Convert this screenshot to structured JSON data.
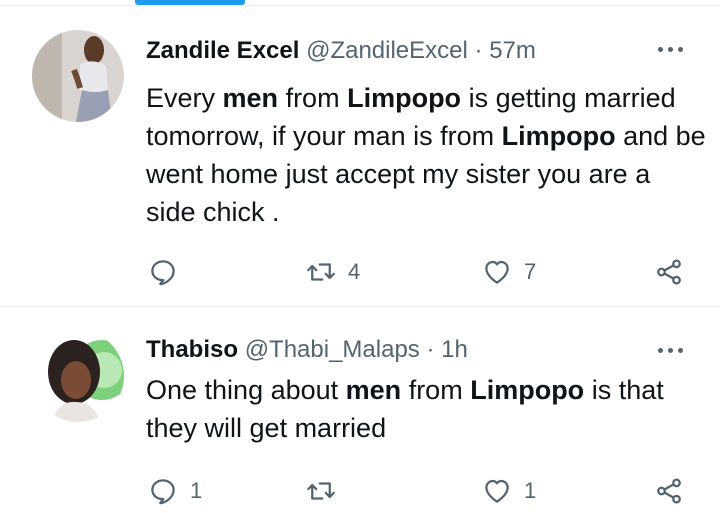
{
  "tweets": [
    {
      "display_name": "Zandile Excel",
      "handle": "@ZandileExcel",
      "separator": "·",
      "time": "57m",
      "text_parts": [
        "Every ",
        "men",
        " from ",
        "Limpopo",
        " is getting married tomorrow, if your man is from ",
        "Limpopo",
        " and be went home just accept my sister you are a side chick ."
      ],
      "replies": "",
      "retweets": "4",
      "likes": "7"
    },
    {
      "display_name": "Thabiso",
      "handle": "@Thabi_Malaps",
      "separator": "·",
      "time": "1h",
      "text_parts": [
        "One thing about ",
        "men",
        " from ",
        "Limpopo",
        " is that they will get married"
      ],
      "replies": "1",
      "retweets": "",
      "likes": "1"
    }
  ],
  "icons": {
    "reply": "reply-icon",
    "retweet": "retweet-icon",
    "like": "heart-icon",
    "share": "share-icon",
    "more": "more-icon"
  },
  "colors": {
    "accent": "#1d9bf0",
    "text": "#0f1419",
    "secondary": "#536471",
    "divider": "#eff3f4"
  }
}
